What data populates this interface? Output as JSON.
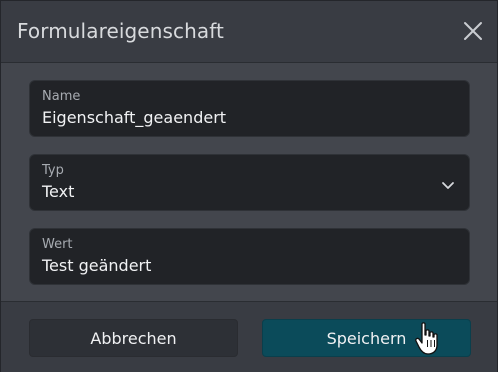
{
  "dialog": {
    "title": "Formulareigenschaft",
    "close_icon": "close-icon"
  },
  "fields": {
    "name": {
      "label": "Name",
      "value": "Eigenschaft_geaendert"
    },
    "type": {
      "label": "Typ",
      "value": "Text",
      "icon": "chevron-down-icon"
    },
    "value": {
      "label": "Wert",
      "value": "Test geändert"
    }
  },
  "footer": {
    "cancel_label": "Abbrechen",
    "save_label": "Speichern"
  },
  "colors": {
    "primary_button": "#0b4b5a",
    "secondary_button": "#2d3036",
    "dialog_bg": "#393c43",
    "body_bg": "#43464d"
  }
}
